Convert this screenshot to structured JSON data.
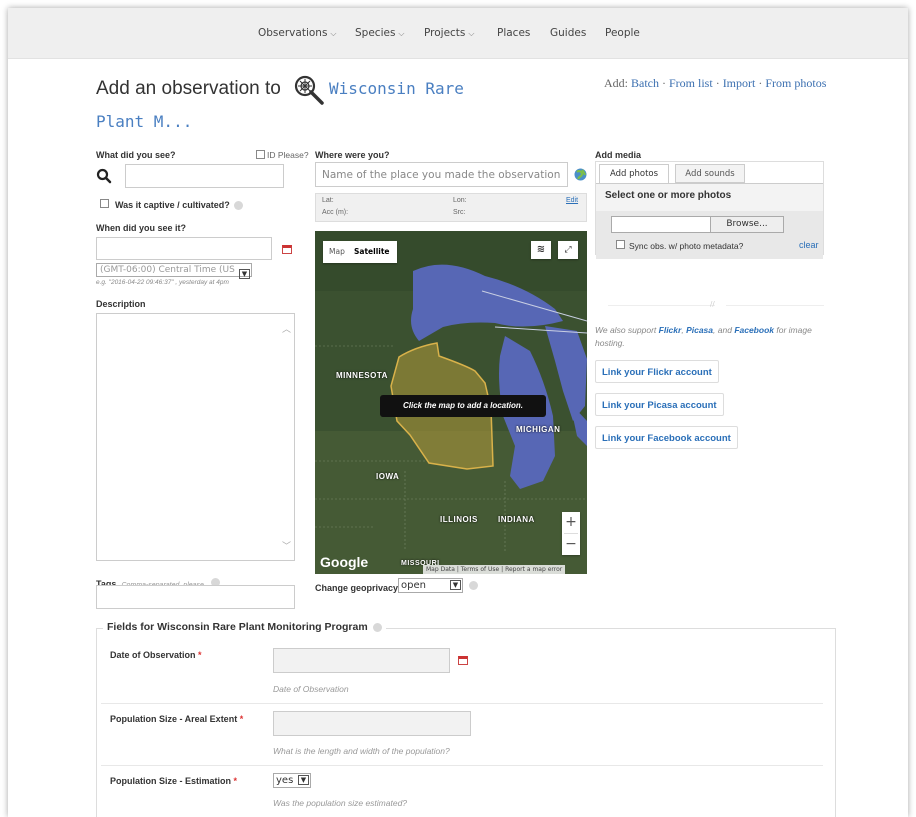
{
  "nav": {
    "items": [
      {
        "label": "Observations",
        "caret": true
      },
      {
        "label": "Species",
        "caret": true
      },
      {
        "label": "Projects",
        "caret": true
      },
      {
        "label": "Places",
        "caret": false
      },
      {
        "label": "Guides",
        "caret": false
      },
      {
        "label": "People",
        "caret": false
      }
    ]
  },
  "header": {
    "title_prefix": "Add an observation to",
    "project_name_line1": "Wisconsin Rare",
    "project_name_line2": "Plant M...",
    "add_label": "Add:",
    "add_links": [
      "Batch",
      "From list",
      "Import",
      "From photos"
    ],
    "separator": "·"
  },
  "what": {
    "label": "What did you see?",
    "id_please": "ID Please?",
    "captive_label": "Was it captive / cultivated?"
  },
  "when": {
    "label": "When did you see it?",
    "timezone": "(GMT-06:00) Central Time (US",
    "hint": "e.g. \"2016-04-22 09:46:37\" , yesterday at 4pm"
  },
  "description": {
    "label": "Description"
  },
  "tags": {
    "label": "Tags",
    "hint": "Comma-separated, please"
  },
  "where": {
    "label": "Where were you?",
    "placeholder": "Name of the place you made the observation",
    "lat_label": "Lat:",
    "lon_label": "Lon:",
    "acc_label": "Acc (m):",
    "src_label": "Src:",
    "edit_label": "Edit"
  },
  "map": {
    "type_map": "Map",
    "type_satellite": "Satellite",
    "tooltip": "Click the map to add a location.",
    "states": [
      "MINNESOTA",
      "MICHIGAN",
      "IOWA",
      "ILLINOIS",
      "INDIANA",
      "MISSOURI"
    ],
    "zoom_in": "+",
    "zoom_out": "−",
    "google": "Google",
    "footer_links": [
      "Map Data",
      "Terms of Use",
      "Report a map error"
    ],
    "colors": {
      "water": "#5767b5",
      "land": "#3f5532",
      "highlight": "#b39a3a"
    }
  },
  "geoprivacy": {
    "label": "Change geoprivacy",
    "value": "open"
  },
  "media": {
    "label": "Add media",
    "tabs": [
      "Add photos",
      "Add sounds"
    ],
    "select_label": "Select one or more photos",
    "browse": "Browse...",
    "sync_label": "Sync obs. w/ photo metadata?",
    "clear": "clear",
    "support_prefix": "We also support",
    "support_flickr": "Flickr",
    "support_picasa": "Picasa",
    "support_and": "and",
    "support_facebook": "Facebook",
    "support_suffix": "for image hosting.",
    "buttons": [
      "Link your Flickr account",
      "Link your Picasa account",
      "Link your Facebook account"
    ]
  },
  "project_fields": {
    "legend": "Fields for Wisconsin Rare Plant Monitoring Program",
    "fields": [
      {
        "label": "Date of Observation",
        "required": "*",
        "hint": "Date of Observation"
      },
      {
        "label": "Population Size - Areal Extent",
        "required": "*",
        "hint": "What is the length and width of the population?"
      },
      {
        "label": "Population Size - Estimation",
        "required": "*",
        "value": "yes",
        "hint": "Was the population size estimated?"
      }
    ]
  }
}
